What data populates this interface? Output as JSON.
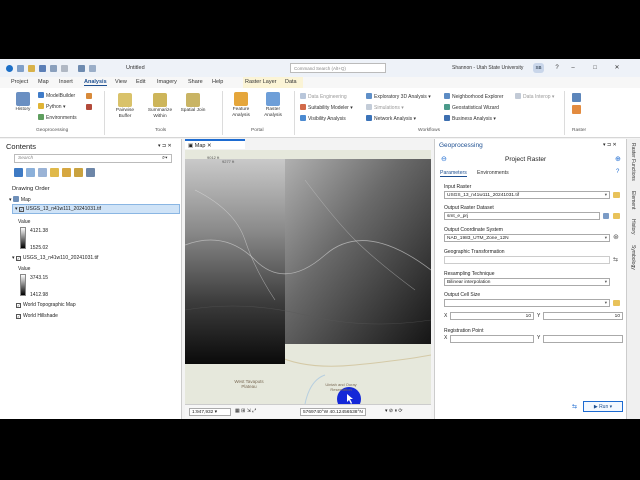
{
  "window": {
    "doc_title": "Untitled",
    "command_search_placeholder": "Command Search (Alt+Q)",
    "user_name": "Shannon - Utah State University",
    "user_initials": "SB"
  },
  "ribbon_tabs": [
    "Project",
    "Map",
    "Insert",
    "Analysis",
    "View",
    "Edit",
    "Imagery",
    "Share",
    "Help",
    "Raster Layer",
    "Data"
  ],
  "ribbon": {
    "history": "History",
    "model_builder": "ModelBuilder",
    "python": "Python",
    "environments": "Environments",
    "geoprocessing_group": "Geoprocessing",
    "pairwise_buffer": "Pairwise Buffer",
    "summarize_within": "Summarize Within",
    "spatial_join": "Spatial Join",
    "tools_group": "Tools",
    "feature_analysis": "Feature Analysis",
    "raster_analysis": "Raster Analysis",
    "portal_group": "Portal",
    "data_engineering": "Data Engineering",
    "suitability_modeler": "Suitability Modeler",
    "visibility_analysis": "Visibility Analysis",
    "exploratory_3d": "Exploratory 3D Analysis",
    "simulations": "Simulations",
    "network_analysis": "Network Analysis",
    "neighborhood_explorer": "Neighborhood Explorer",
    "geostatistical_wizard": "Geostatistical Wizard",
    "business_analysis": "Business Analysis",
    "data_interop": "Data Interop",
    "workflows_group": "Workflows",
    "raster_group": "Raster"
  },
  "contents": {
    "title": "Contents",
    "search_placeholder": "Search",
    "drawing_order": "Drawing Order",
    "map_name": "Map",
    "layers": [
      {
        "name": "USGS_13_n41w111_20241031.tif",
        "value_label": "Value",
        "max": "4121.38",
        "min": "1525.02",
        "selected": true
      },
      {
        "name": "USGS_13_n41w110_20241031.tif",
        "value_label": "Value",
        "max": "3743.15",
        "min": "1412.98",
        "selected": false
      }
    ],
    "basemaps": [
      "World Topographic Map",
      "World Hillshade"
    ]
  },
  "map": {
    "tab_label": "Map",
    "scale": "1:947,932",
    "coordinates": "5769740°W 40.12456538°N",
    "labels": [
      "West Tavaputs Plateau",
      "Uintah and Ouray Reservation",
      "9012 ft",
      "9277 ft"
    ]
  },
  "geoprocessing": {
    "title": "Geoprocessing",
    "tool_name": "Project Raster",
    "tabs": [
      "Parameters",
      "Environments"
    ],
    "input_raster_label": "Input Raster",
    "input_raster_value": "USGS_13_n41w111_20241031.tif",
    "output_dataset_label": "Output Raster Dataset",
    "output_dataset_value": "smt_e_prj",
    "output_cs_label": "Output Coordinate System",
    "output_cs_value": "NAD_1983_UTM_Zone_12N",
    "geo_transform_label": "Geographic Transformation",
    "resampling_label": "Resampling Technique",
    "resampling_value": "Bilinear interpolation",
    "cell_size_label": "Output Cell Size",
    "x_label": "X",
    "x_value": "10",
    "y_label": "Y",
    "y_value": "10",
    "registration_label": "Registration Point",
    "run_label": "Run"
  },
  "side_tabs": [
    "Raster Functions",
    "Element",
    "History",
    "Symbology"
  ],
  "colors": {
    "accent": "#1d6bd1",
    "cursor": "#1428d8"
  }
}
